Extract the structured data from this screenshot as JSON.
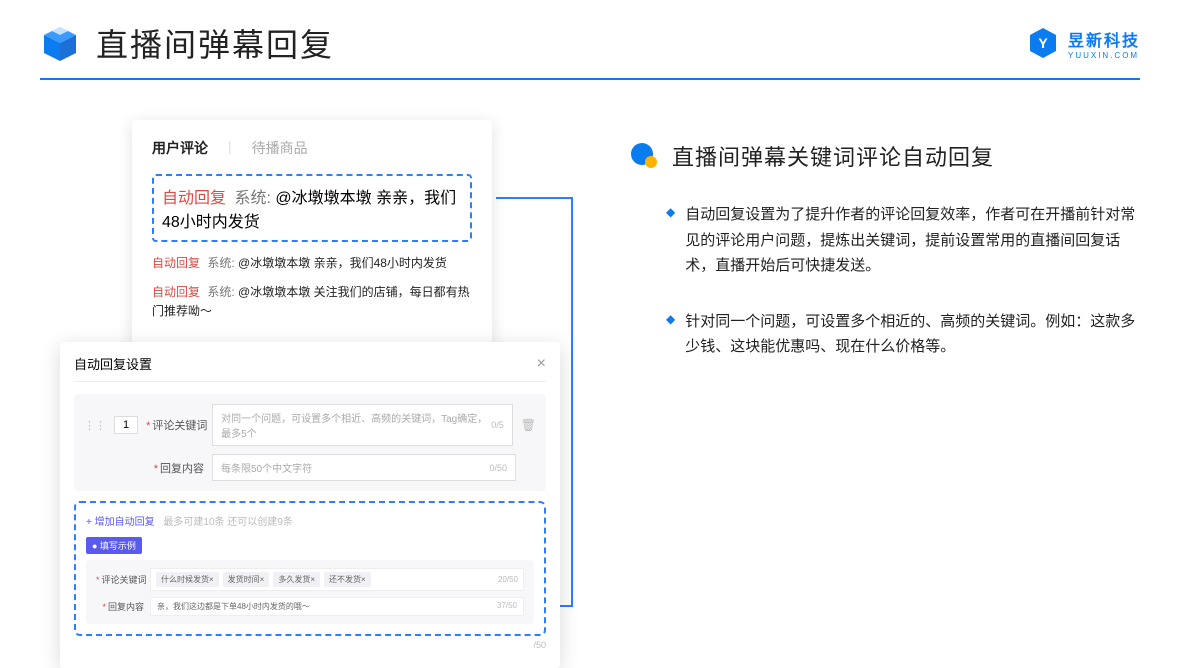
{
  "header": {
    "title": "直播间弹幕回复",
    "logo_cn": "昱新科技",
    "logo_en": "YUUXIN.COM"
  },
  "panel1": {
    "tab_active": "用户评论",
    "tab_inactive": "待播商品",
    "highlight": {
      "tag": "自动回复",
      "sys": "系统:",
      "text": "@冰墩墩本墩 亲亲，我们48小时内发货"
    },
    "rows": [
      {
        "tag": "自动回复",
        "sys": "系统:",
        "text": "@冰墩墩本墩 亲亲，我们48小时内发货"
      },
      {
        "tag": "自动回复",
        "sys": "系统:",
        "text": "@冰墩墩本墩 关注我们的店铺，每日都有热门推荐呦～"
      }
    ]
  },
  "panel2": {
    "title": "自动回复设置",
    "num": "1",
    "keyword_label": "评论关键词",
    "keyword_placeholder": "对同一个问题，可设置多个相近、高频的关键词，Tag确定，最多5个",
    "keyword_count": "0/5",
    "content_label": "回复内容",
    "content_placeholder": "每条限50个中文字符",
    "content_count": "0/50",
    "add_text": "+ 增加自动回复",
    "add_hint": "最多可建10条 还可以创建9条",
    "badge": "● 填写示例",
    "ex_keyword_label": "评论关键词",
    "ex_tags": [
      "什么时候发货×",
      "发货时间×",
      "多久发货×",
      "还不发货×"
    ],
    "ex_keyword_count": "20/50",
    "ex_content_label": "回复内容",
    "ex_content_value": "亲，我们这边都是下单48小时内发货的哦～",
    "ex_content_count": "37/50",
    "bottom_count": "/50"
  },
  "right": {
    "title": "直播间弹幕关键词评论自动回复",
    "bullets": [
      "自动回复设置为了提升作者的评论回复效率，作者可在开播前针对常见的评论用户问题，提炼出关键词，提前设置常用的直播间回复话术，直播开始后可快捷发送。",
      "针对同一个问题，可设置多个相近的、高频的关键词。例如：这款多少钱、这块能优惠吗、现在什么价格等。"
    ]
  }
}
